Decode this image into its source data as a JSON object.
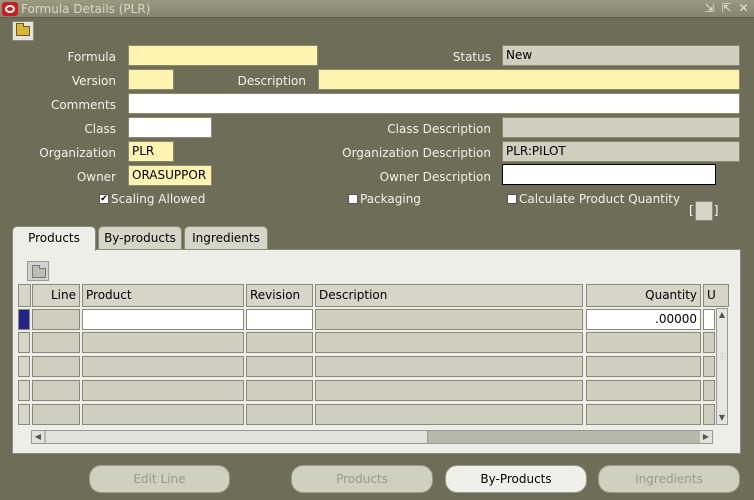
{
  "window": {
    "title": "Formula Details (PLR)",
    "controls": [
      "⇲",
      "⇱",
      "✕"
    ]
  },
  "form": {
    "formula_label": "Formula",
    "formula_value": "",
    "status_label": "Status",
    "status_value": "New",
    "version_label": "Version",
    "version_value": "",
    "description_label": "Description",
    "description_value": "",
    "comments_label": "Comments",
    "comments_value": "",
    "class_label": "Class",
    "class_value": "",
    "class_desc_label": "Class Description",
    "class_desc_value": "",
    "org_label": "Organization",
    "org_value": "PLR",
    "org_desc_label": "Organization Description",
    "org_desc_value": "PLR:PILOT",
    "owner_label": "Owner",
    "owner_value": "ORASUPPOR",
    "owner_desc_label": "Owner Description",
    "owner_desc_value": "",
    "scaling_label": "Scaling Allowed",
    "scaling_checked": true,
    "packaging_label": "Packaging",
    "packaging_checked": false,
    "calc_label": "Calculate Product Quantity",
    "calc_checked": false,
    "bracket_open": "[",
    "bracket_close": "]"
  },
  "tabs": [
    {
      "label": "Products",
      "active": true
    },
    {
      "label": "By-products",
      "active": false
    },
    {
      "label": "Ingredients",
      "active": false
    }
  ],
  "table": {
    "columns": [
      "Line",
      "Product",
      "Revision",
      "Description",
      "Quantity",
      "U"
    ],
    "rows": [
      {
        "line": "",
        "product": "",
        "revision": "",
        "description": "",
        "quantity": ".00000"
      },
      {
        "line": "",
        "product": "",
        "revision": "",
        "description": "",
        "quantity": ""
      },
      {
        "line": "",
        "product": "",
        "revision": "",
        "description": "",
        "quantity": ""
      },
      {
        "line": "",
        "product": "",
        "revision": "",
        "description": "",
        "quantity": ""
      },
      {
        "line": "",
        "product": "",
        "revision": "",
        "description": "",
        "quantity": ""
      }
    ]
  },
  "buttons": {
    "edit_line": "Edit Line",
    "products": "Products",
    "by_products": "By-Products",
    "ingredients": "Ingredients"
  },
  "colors": {
    "required": "#fff3b0",
    "readonly": "#cfcfbf",
    "background": "#6e6e58"
  }
}
